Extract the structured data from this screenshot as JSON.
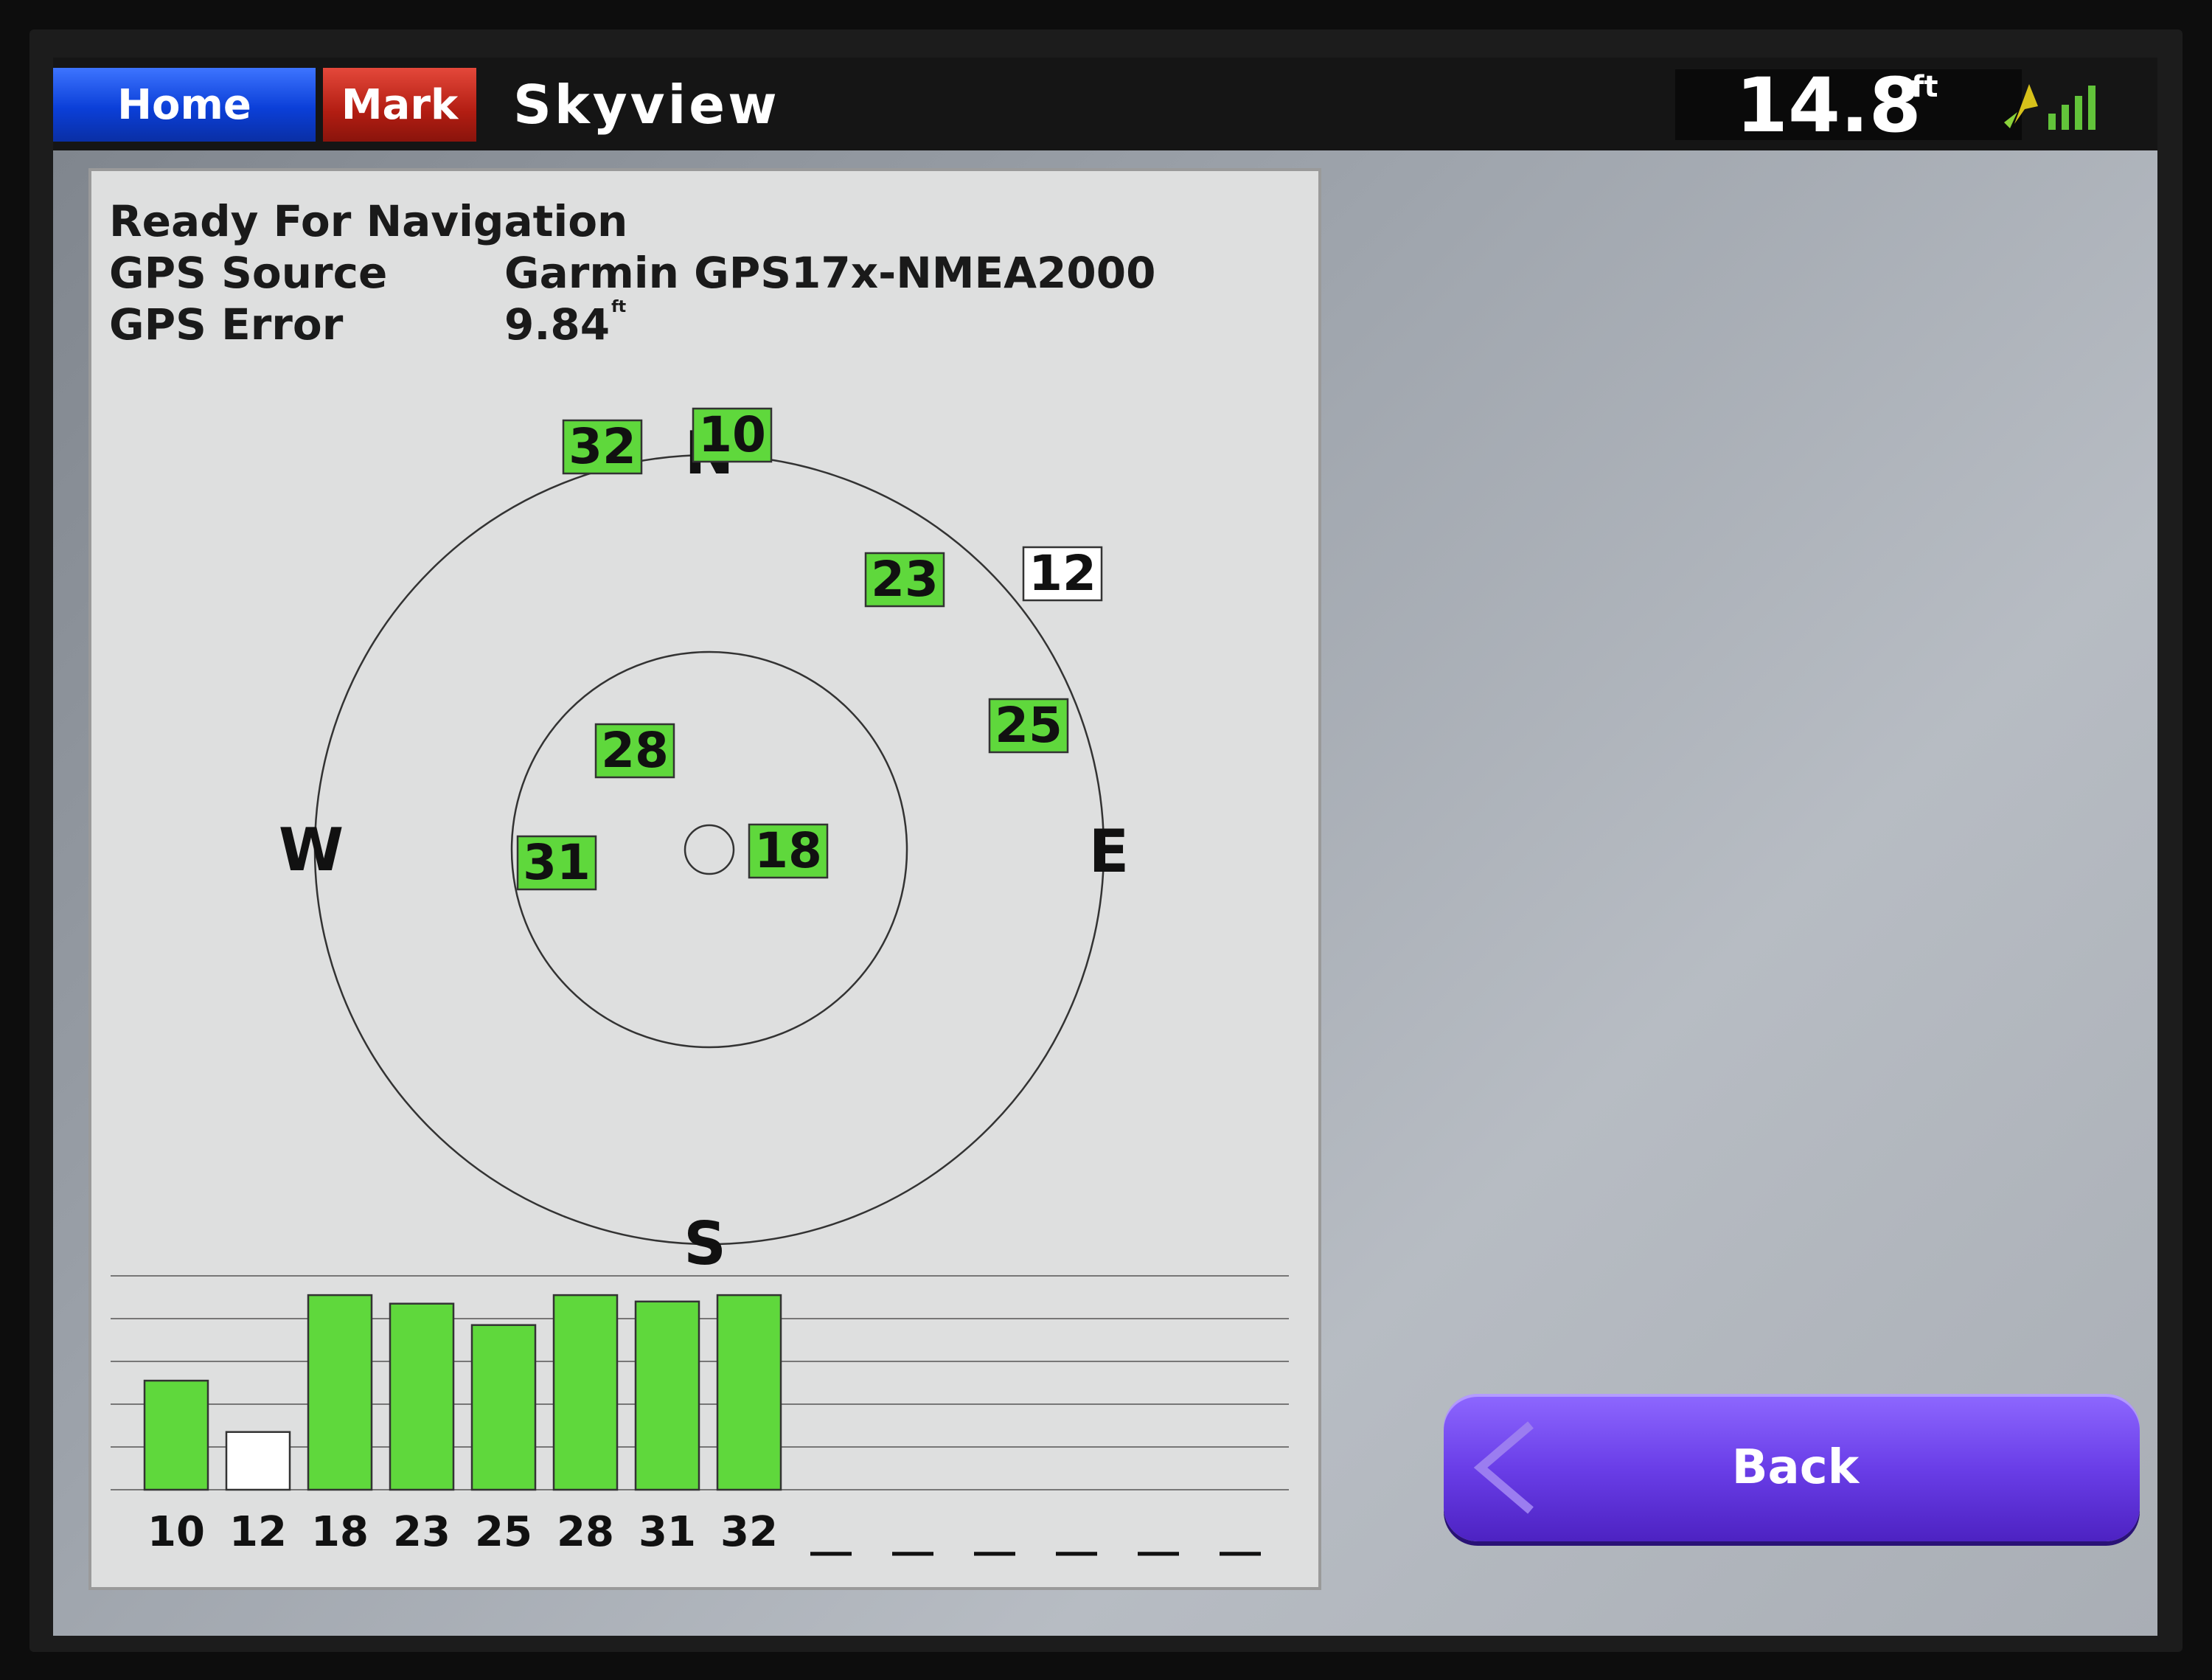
{
  "header": {
    "home_label": "Home",
    "mark_label": "Mark",
    "title": "Skyview",
    "depth_value": "14.8",
    "depth_unit": "ft"
  },
  "info": {
    "status": "Ready For Navigation",
    "gps_source_label": "GPS Source",
    "gps_source_value": "Garmin GPS17x-NMEA2000",
    "gps_error_label": "GPS Error",
    "gps_error_value": "9.84",
    "gps_error_unit": "ft"
  },
  "compass": {
    "north": "N",
    "south": "S",
    "east": "E",
    "west": "W"
  },
  "satellites": [
    {
      "id": "32",
      "fix": true
    },
    {
      "id": "10",
      "fix": true
    },
    {
      "id": "23",
      "fix": true
    },
    {
      "id": "12",
      "fix": false
    },
    {
      "id": "25",
      "fix": true
    },
    {
      "id": "28",
      "fix": true
    },
    {
      "id": "18",
      "fix": true
    },
    {
      "id": "31",
      "fix": true
    }
  ],
  "chart_data": {
    "type": "bar",
    "categories": [
      "10",
      "12",
      "18",
      "23",
      "25",
      "28",
      "31",
      "32",
      "__",
      "__",
      "__",
      "__",
      "__",
      "__"
    ],
    "values": [
      0.51,
      0.27,
      0.91,
      0.87,
      0.77,
      0.91,
      0.88,
      0.91,
      0,
      0,
      0,
      0,
      0,
      0
    ],
    "locked": [
      true,
      false,
      true,
      true,
      true,
      true,
      true,
      true,
      false,
      false,
      false,
      false,
      false,
      false
    ],
    "ylim": [
      0,
      1
    ],
    "grid": true
  },
  "colors": {
    "locked": "#5fd83c",
    "unlocked": "#ffffff",
    "home_tab": "#0b3fd8",
    "mark_tab": "#b21d12",
    "back_button": "#6a3ee8"
  },
  "back_button": {
    "label": "Back",
    "icon": "chevron-left-icon"
  }
}
